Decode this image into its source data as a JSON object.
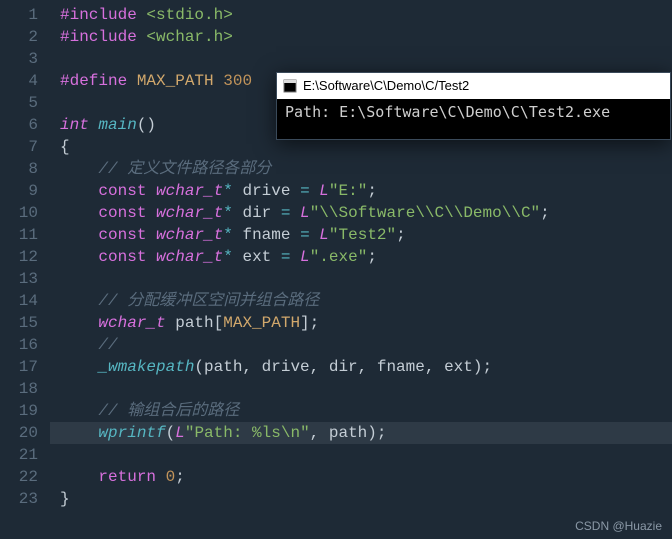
{
  "lines": {
    "count": 23,
    "highlight": 20
  },
  "code": {
    "l1a": "#include",
    "l1b": " <stdio.h>",
    "l2a": "#include",
    "l2b": " <wchar.h>",
    "l4a": "#define",
    "l4b": " MAX_PATH",
    "l4c": " 300",
    "l6a": "int",
    "l6b": " ",
    "l6c": "main",
    "l6d": "()",
    "l7": "{",
    "l8a": "    ",
    "l8b": "// 定义文件路径各部分",
    "l9a": "    ",
    "l9b": "const",
    "l9c": " ",
    "l9d": "wchar_t",
    "l9e": "*",
    "l9f": " drive ",
    "l9g": "=",
    "l9h": " ",
    "l9i": "L",
    "l9j": "\"E:\"",
    "l9k": ";",
    "l10a": "    ",
    "l10b": "const",
    "l10c": " ",
    "l10d": "wchar_t",
    "l10e": "*",
    "l10f": " dir ",
    "l10g": "=",
    "l10h": " ",
    "l10i": "L",
    "l10j": "\"\\\\Software\\\\C\\\\Demo\\\\C\"",
    "l10k": ";",
    "l11a": "    ",
    "l11b": "const",
    "l11c": " ",
    "l11d": "wchar_t",
    "l11e": "*",
    "l11f": " fname ",
    "l11g": "=",
    "l11h": " ",
    "l11i": "L",
    "l11j": "\"Test2\"",
    "l11k": ";",
    "l12a": "    ",
    "l12b": "const",
    "l12c": " ",
    "l12d": "wchar_t",
    "l12e": "*",
    "l12f": " ext ",
    "l12g": "=",
    "l12h": " ",
    "l12i": "L",
    "l12j": "\".exe\"",
    "l12k": ";",
    "l14a": "    ",
    "l14b": "// 分配缓冲区空间并组合路径",
    "l15a": "    ",
    "l15b": "wchar_t",
    "l15c": " path[",
    "l15d": "MAX_PATH",
    "l15e": "];",
    "l16a": "    ",
    "l16b": "//",
    "l17a": "    ",
    "l17b": "_wmakepath",
    "l17c": "(path, drive, dir, fname, ext);",
    "l19a": "    ",
    "l19b": "// 输组合后的路径",
    "l20a": "    ",
    "l20b": "wprintf",
    "l20c": "(",
    "l20d": "L",
    "l20e": "\"Path: %ls\\n\"",
    "l20f": ", path);",
    "l22a": "    ",
    "l22b": "return",
    "l22c": " ",
    "l22d": "0",
    "l22e": ";",
    "l23": "}"
  },
  "console": {
    "title": "E:\\Software\\C\\Demo\\C/Test2",
    "output": "Path: E:\\Software\\C\\Demo\\C\\Test2.exe"
  },
  "watermark": "CSDN @Huazie"
}
